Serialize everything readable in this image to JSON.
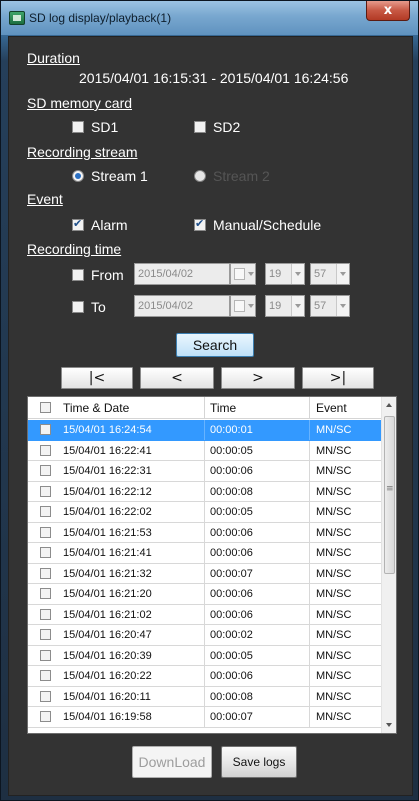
{
  "window": {
    "title": "SD log display/playback(1)",
    "close_glyph": "x"
  },
  "duration": {
    "heading": "Duration",
    "value": "2015/04/01 16:15:31 - 2015/04/01 16:24:56"
  },
  "sd_card": {
    "heading": "SD memory card",
    "sd1": "SD1",
    "sd2": "SD2"
  },
  "stream": {
    "heading": "Recording stream",
    "stream1": "Stream 1",
    "stream2": "Stream 2"
  },
  "event": {
    "heading": "Event",
    "alarm": "Alarm",
    "manual": "Manual/Schedule"
  },
  "rec_time": {
    "heading": "Recording time",
    "from_label": "From",
    "to_label": "To",
    "from_date": "2015/04/02",
    "from_hour": "19",
    "from_min": "57",
    "to_date": "2015/04/02",
    "to_hour": "19",
    "to_min": "57"
  },
  "search_label": "Search",
  "nav": {
    "first": "|<",
    "prev": "<",
    "next": ">",
    "last": ">|"
  },
  "table": {
    "headers": {
      "time_date": "Time & Date",
      "time": "Time",
      "event": "Event"
    },
    "rows": [
      {
        "dt": "15/04/01 16:24:54",
        "t": "00:00:01",
        "ev": "MN/SC"
      },
      {
        "dt": "15/04/01 16:22:41",
        "t": "00:00:05",
        "ev": "MN/SC"
      },
      {
        "dt": "15/04/01 16:22:31",
        "t": "00:00:06",
        "ev": "MN/SC"
      },
      {
        "dt": "15/04/01 16:22:12",
        "t": "00:00:08",
        "ev": "MN/SC"
      },
      {
        "dt": "15/04/01 16:22:02",
        "t": "00:00:05",
        "ev": "MN/SC"
      },
      {
        "dt": "15/04/01 16:21:53",
        "t": "00:00:06",
        "ev": "MN/SC"
      },
      {
        "dt": "15/04/01 16:21:41",
        "t": "00:00:06",
        "ev": "MN/SC"
      },
      {
        "dt": "15/04/01 16:21:32",
        "t": "00:00:07",
        "ev": "MN/SC"
      },
      {
        "dt": "15/04/01 16:21:20",
        "t": "00:00:06",
        "ev": "MN/SC"
      },
      {
        "dt": "15/04/01 16:21:02",
        "t": "00:00:06",
        "ev": "MN/SC"
      },
      {
        "dt": "15/04/01 16:20:47",
        "t": "00:00:02",
        "ev": "MN/SC"
      },
      {
        "dt": "15/04/01 16:20:39",
        "t": "00:00:05",
        "ev": "MN/SC"
      },
      {
        "dt": "15/04/01 16:20:22",
        "t": "00:00:06",
        "ev": "MN/SC"
      },
      {
        "dt": "15/04/01 16:20:11",
        "t": "00:00:08",
        "ev": "MN/SC"
      },
      {
        "dt": "15/04/01 16:19:58",
        "t": "00:00:07",
        "ev": "MN/SC"
      }
    ]
  },
  "download_label": "DownLoad",
  "save_logs_label": "Save logs",
  "colors": {
    "selection": "#3399ff",
    "background": "#333333",
    "title_bar": "#78a7cf",
    "close_button": "#c75844"
  }
}
